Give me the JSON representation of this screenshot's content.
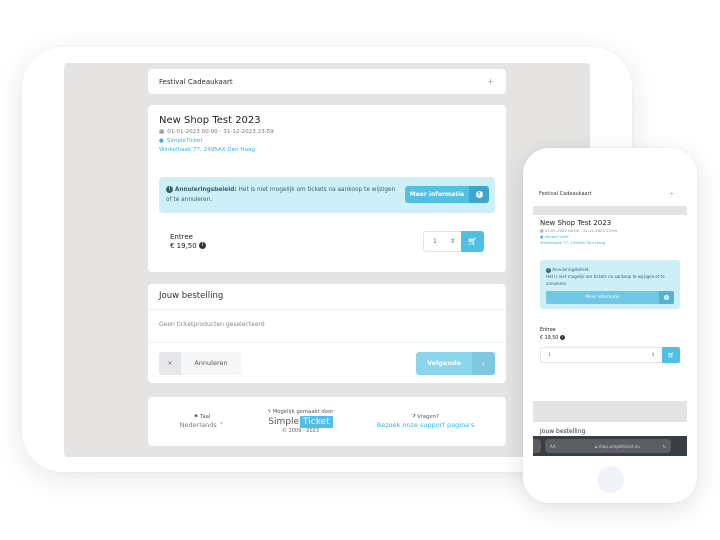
{
  "shop": {
    "gift_card": {
      "title": "Festival Cadeaukaart",
      "toggle": "+"
    },
    "event": {
      "title": "New Shop Test 2023",
      "dates": "01-01-2023 00:00 - 31-12-2023 23:59",
      "venue": "SimpleTicket",
      "address": "Winkelhaak 77, 2495AX Den Haag"
    },
    "notice": {
      "label": "Annuleringsbeleid:",
      "text": "Het is niet mogelijk om tickets na aankoop te wijzigen of te annuleren.",
      "button": "Meer informatie"
    },
    "ticket": {
      "name": "Entree",
      "price": "€ 19,50",
      "quantity": "1"
    },
    "order": {
      "title": "Jouw bestelling",
      "empty": "Geen ticketproducten geselecteerd",
      "cancel": "Annuleren",
      "next": "Volgende"
    },
    "footer": {
      "language_caption": "Taal",
      "language_value": "Nederlands",
      "powered_caption": "Mogelijk gemaakt door",
      "logo_left": "Simple",
      "logo_right": "Ticket",
      "copyright": "© 2009 - 2023",
      "support_caption": "Vragen?",
      "support_link": "Bezoek onze support pagina's"
    }
  },
  "phone_browser": {
    "text_size": "AA",
    "url": "shop.simpleticket.eu"
  }
}
